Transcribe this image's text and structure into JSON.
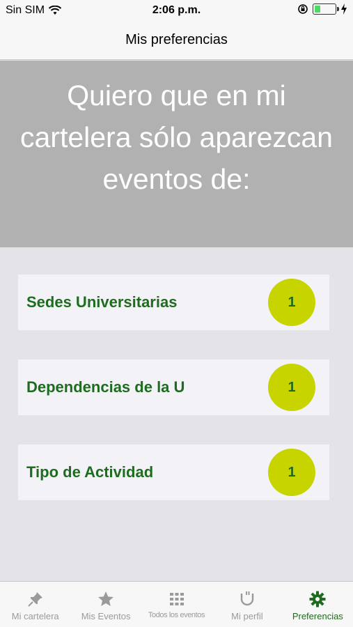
{
  "status_bar": {
    "carrier": "Sin SIM",
    "time": "2:06 p.m.",
    "battery_level": 0.3,
    "icons": [
      "wifi-icon",
      "orientation-lock-icon",
      "battery-icon",
      "charging-icon"
    ]
  },
  "nav": {
    "title": "Mis preferencias"
  },
  "hero": {
    "text": "Quiero que en mi cartelera sólo aparezcan eventos de:"
  },
  "filters": [
    {
      "label": "Sedes Universitarias",
      "count": "1"
    },
    {
      "label": "Dependencias de la U",
      "count": "1"
    },
    {
      "label": "Tipo de Actividad",
      "count": "1"
    }
  ],
  "tabs": [
    {
      "label": "Mi cartelera",
      "icon": "pin-icon",
      "active": false
    },
    {
      "label": "Mis Eventos",
      "icon": "star-icon",
      "active": false
    },
    {
      "label": "Todos los eventos",
      "icon": "grid-icon",
      "active": false
    },
    {
      "label": "Mi perfil",
      "icon": "profile-icon",
      "active": false
    },
    {
      "label": "Preferencias",
      "icon": "gear-icon",
      "active": true
    }
  ],
  "colors": {
    "accent_green": "#1f6b1f",
    "badge_yellow": "#c8d400",
    "hero_gray": "#b1b1b1",
    "tab_inactive": "#9a9a9a"
  }
}
